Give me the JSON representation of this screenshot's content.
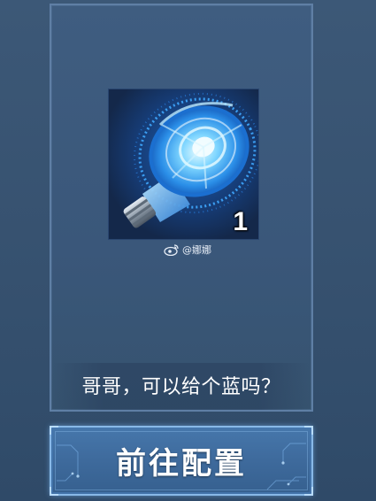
{
  "item": {
    "icon": "loudspeaker-icon",
    "count": "1"
  },
  "watermark": {
    "icon": "weibo-icon",
    "text": "@娜娜"
  },
  "message": "哥哥，可以给个蓝吗？",
  "cta": {
    "label": "前往配置"
  },
  "colors": {
    "background": "#3a5676",
    "card": "#3d5b7d",
    "card_border": "#5f7fa5",
    "button": "#3e6a9c",
    "button_border": "#88b9e8",
    "glow": "#3fa8ff"
  }
}
